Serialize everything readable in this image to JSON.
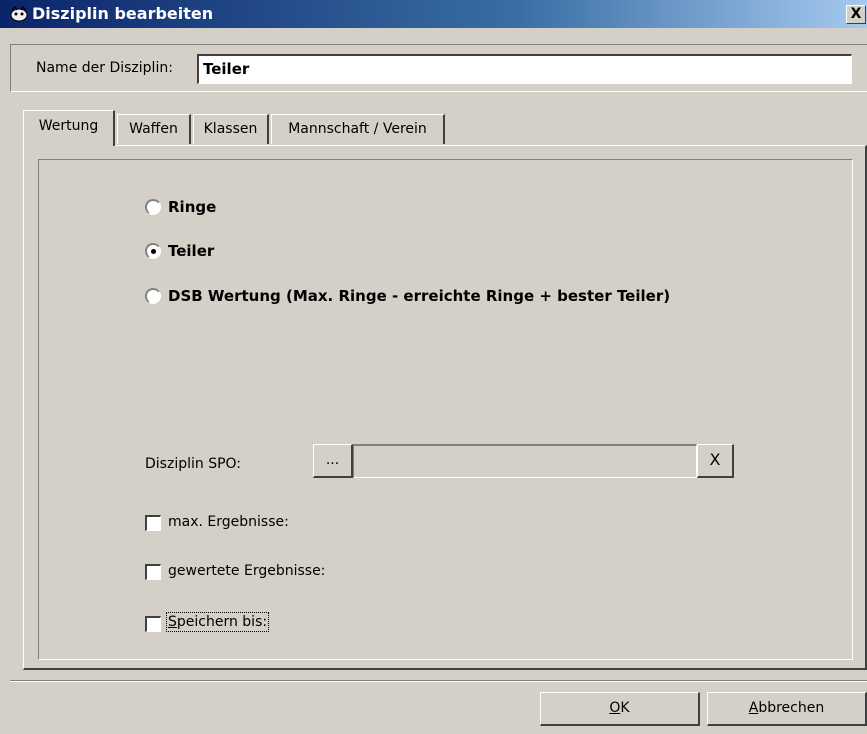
{
  "window": {
    "title": "Disziplin bearbeiten",
    "close_label": "X"
  },
  "name_row": {
    "label": "Name der Disziplin:",
    "value": "Teiler"
  },
  "tabs": [
    {
      "label": "Wertung",
      "active": true
    },
    {
      "label": "Waffen",
      "active": false
    },
    {
      "label": "Klassen",
      "active": false
    },
    {
      "label": "Mannschaft / Verein",
      "active": false
    }
  ],
  "scoring": {
    "options": [
      {
        "label": "Ringe",
        "selected": false
      },
      {
        "label": "Teiler",
        "selected": true
      },
      {
        "label": "DSB Wertung (Max. Ringe - erreichte Ringe + bester Teiler)",
        "selected": false
      }
    ]
  },
  "spo": {
    "label": "Disziplin SPO:",
    "browse_label": "...",
    "value": "",
    "clear_label": "X"
  },
  "checkboxes": [
    {
      "label": "max. Ergebnisse:",
      "checked": false
    },
    {
      "label": "gewertete Ergebnisse:",
      "checked": false
    },
    {
      "label_prefix": "S",
      "label_rest": "peichern bis:",
      "checked": false
    }
  ],
  "buttons": {
    "ok_prefix": "O",
    "ok_rest": "K",
    "cancel_prefix": "A",
    "cancel_rest": "bbrechen"
  },
  "colors": {
    "face": "#d4d0c8",
    "title_start": "#0a246a",
    "title_end": "#a6caf0"
  }
}
